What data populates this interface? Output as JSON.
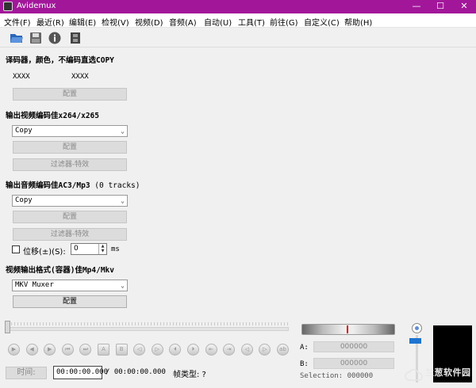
{
  "app": {
    "title": "Avidemux",
    "minimize_glyph": "—",
    "maximize_glyph": "☐",
    "close_glyph": "✕"
  },
  "colors": {
    "titlebar": "#a2179a",
    "volume_thumb": "#1e74d0",
    "jog_marker": "#dd0000"
  },
  "menu": [
    "文件(F)",
    "最近(R)",
    "编辑(E)",
    "检视(V)",
    "视频(D)",
    "音频(A)",
    "自动(U)",
    "工具(T)",
    "前往(G)",
    "自定义(C)",
    "帮助(H)"
  ],
  "toolbar": {
    "icons": [
      "open-folder-icon",
      "save-icon",
      "info-icon",
      "film-icon"
    ]
  },
  "decoder": {
    "title": "译码器，颜色，不编码直选COPY",
    "video_codec": "XXXX",
    "audio_codec": "XXXX",
    "configure_label": "配置"
  },
  "video_output": {
    "title": "输出视频编码佳x264/x265",
    "codec_value": "Copy",
    "configure_label": "配置",
    "filters_label": "过滤器-特效"
  },
  "audio_output": {
    "title": "输出音频编码佳AC3/Mp3",
    "tracks_note": "(0 tracks)",
    "codec_value": "Copy",
    "configure_label": "配置",
    "filters_label": "过滤器-特效",
    "shift_label": "位移(±)(S):",
    "shift_value": "0",
    "shift_unit": "ms"
  },
  "container": {
    "title": "视频输出格式(容器)佳Mp4/Mkv",
    "muxer_value": "MKV Muxer",
    "configure_label": "配置"
  },
  "playback": {
    "timeline_position": 0,
    "nav_buttons": [
      "play-icon",
      "rewind-icon",
      "forward-icon",
      "previous-keyframe-icon",
      "next-keyframe-icon",
      "set-marker-a-icon",
      "set-marker-b-icon",
      "previous-black-frame-icon",
      "next-black-frame-icon",
      "first-frame-icon",
      "last-frame-icon",
      "goto-marker-a-icon",
      "goto-marker-b-icon",
      "previous-cut-icon",
      "next-cut-icon",
      "extra-nav-icon"
    ],
    "nav_glyphs": [
      "▶",
      "◀",
      "▶",
      "⏮",
      "⏭",
      "A",
      "B",
      "◁",
      "▷",
      "⏴",
      "⏵",
      "⇤",
      "⇥",
      "◁",
      "▷",
      "ab"
    ]
  },
  "markers": {
    "a_label": "A:",
    "a_value": "000000",
    "b_label": "B:",
    "b_value": "000000",
    "selection_label": "Selection:",
    "selection_value": "000000"
  },
  "time": {
    "label": "时间:",
    "current": "00:00:00.000",
    "total": "/ 00:00:00.000",
    "frame_type": "帧类型: ?"
  },
  "volume": {
    "level": 0.9
  },
  "watermark": {
    "text": "兰葱软件园"
  }
}
